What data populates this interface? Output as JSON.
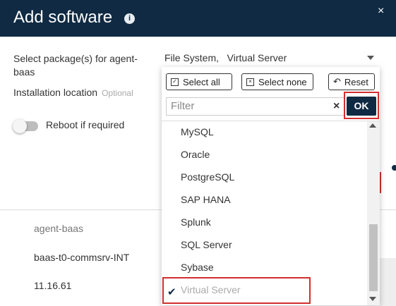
{
  "header": {
    "title": "Add software",
    "info_icon": "i",
    "close_icon": "×"
  },
  "form": {
    "packages_label": "Select package(s) for agent-baas",
    "packages_value": "File System,   Virtual Server",
    "location_label": "Installation location",
    "location_optional": "Optional",
    "reboot_label": "Reboot if required",
    "reboot_checked": false
  },
  "lower": {
    "rows": [
      "agent-baas",
      "baas-t0-commsrv-INT",
      "11.16.61"
    ]
  },
  "dropdown": {
    "select_all": "Select all",
    "select_none": "Select none",
    "reset": "Reset",
    "filter_placeholder": "Filter",
    "ok": "OK",
    "items": [
      {
        "label": "MySQL",
        "selected": false
      },
      {
        "label": "Oracle",
        "selected": false
      },
      {
        "label": "PostgreSQL",
        "selected": false
      },
      {
        "label": "SAP HANA",
        "selected": false
      },
      {
        "label": "Splunk",
        "selected": false
      },
      {
        "label": "SQL Server",
        "selected": false
      },
      {
        "label": "Sybase",
        "selected": false
      },
      {
        "label": "Virtual Server",
        "selected": true
      }
    ]
  },
  "colors": {
    "header_bg": "#102a43",
    "highlight": "#d32f2f"
  }
}
